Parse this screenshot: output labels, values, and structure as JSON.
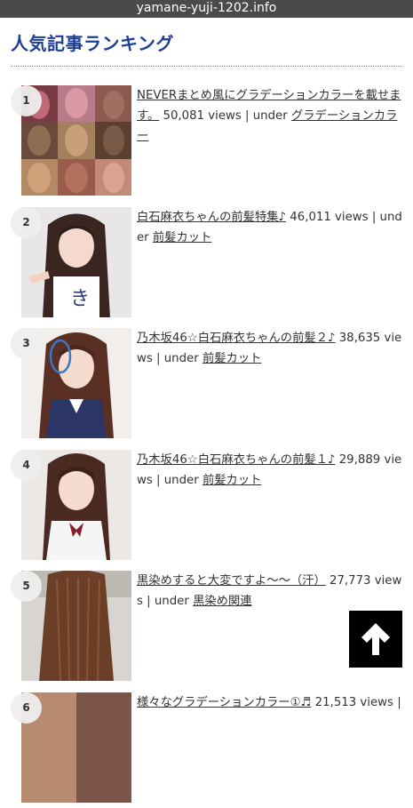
{
  "browser": {
    "url": "yamane-yuji-1202.info"
  },
  "section": {
    "title": "人気記事ランキング"
  },
  "ranking": [
    {
      "rank": "1",
      "title": "NEVERまとめ風にグラデーションカラーを載せます。",
      "views": "50,081 views",
      "under": "| under",
      "category": "グラデーションカラー"
    },
    {
      "rank": "2",
      "title": "白石麻衣ちゃんの前髪特集♪",
      "views": "46,011 views",
      "under": "| under",
      "category": "前髪カット"
    },
    {
      "rank": "3",
      "title": "乃木坂46☆白石麻衣ちゃんの前髪２♪",
      "views": "38,635 views",
      "under": "| under",
      "category": "前髪カット"
    },
    {
      "rank": "4",
      "title": "乃木坂46☆白石麻衣ちゃんの前髪１♪",
      "views": "29,889 views",
      "under": "| under",
      "category": "前髪カット"
    },
    {
      "rank": "5",
      "title": "黒染めすると大変ですよ～～（汗）",
      "views": "27,773 views",
      "under": "| under",
      "category": "黒染め関連"
    },
    {
      "rank": "6",
      "title": "様々なグラデーションカラー①♬",
      "views": "21,513 views",
      "under": "|",
      "category": ""
    }
  ],
  "icons": {
    "back_to_top": "arrow-up-icon"
  },
  "colors": {
    "heading": "#1f3f92",
    "url_bar": "#4a4a4a",
    "back_to_top": "#000000"
  }
}
